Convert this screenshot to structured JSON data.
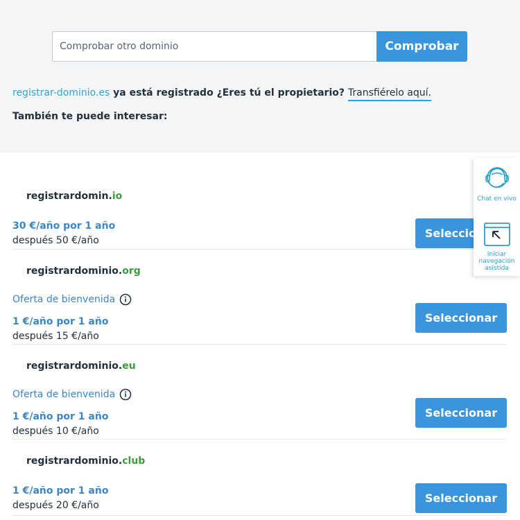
{
  "search": {
    "placeholder": "Comprobar otro dominio",
    "button_label": "Comprobar"
  },
  "notice": {
    "domain": "registrar-dominio.es",
    "text": " ya está registrado ¿Eres tú el propietario? ",
    "transfer_link": "Transfiérelo aquí."
  },
  "also_label": "También te puede interesar:",
  "results": [
    {
      "name": "registrardomin.",
      "tld": "io",
      "offer": "",
      "price": "30 €/año por 1 año",
      "after": "después 50 €/año",
      "button": "Seleccionar"
    },
    {
      "name": "registrardominio.",
      "tld": "org",
      "offer": "Oferta de bienvenida",
      "price": "1 €/año por 1 año",
      "after": "después 15 €/año",
      "button": "Seleccionar"
    },
    {
      "name": "registrardominio.",
      "tld": "eu",
      "offer": "Oferta de bienvenida",
      "price": "1 €/año por 1 año",
      "after": "después 10 €/año",
      "button": "Seleccionar"
    },
    {
      "name": "registrardominio.",
      "tld": "club",
      "offer": "",
      "price": "1 €/año por 1 año",
      "after": "después 20 €/año",
      "button": "Seleccionar"
    }
  ],
  "widget": {
    "chat_label": "Chat en vivo",
    "nav_label": "Iniciar navegación asistida"
  },
  "colors": {
    "accent": "#3a96dc",
    "link": "#2ba5d6",
    "tld": "#3c9c3c",
    "price": "#3a86c8"
  },
  "icons": {
    "info": "info-circle-icon",
    "chat": "agent-headset-icon",
    "nav": "arrow-up-left-window-icon"
  }
}
